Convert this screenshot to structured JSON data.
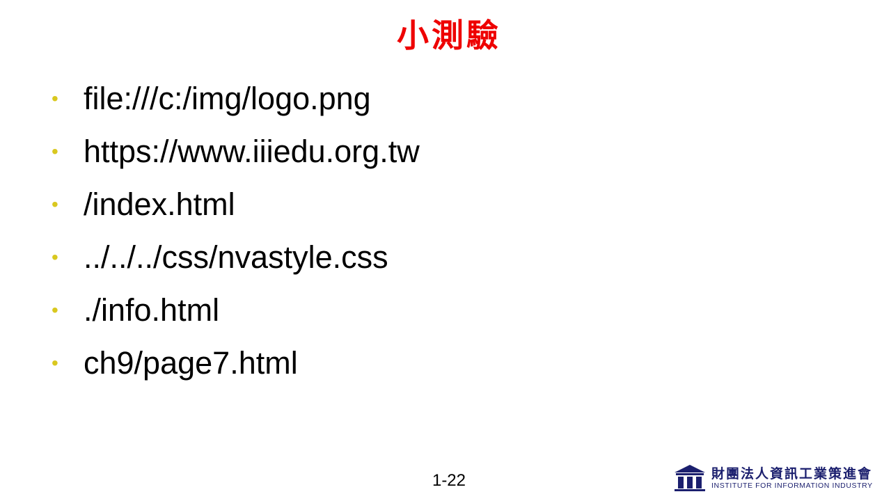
{
  "slide": {
    "title": "小測驗",
    "bullet_glyph": "•",
    "bullets": [
      "file:///c:/img/logo.png",
      "https://www.iiiedu.org.tw",
      "/index.html",
      "../../../css/nvastyle.css",
      "./info.html",
      "ch9/page7.html"
    ],
    "page_number": "1-22"
  },
  "logo": {
    "chinese_name": "財團法人資訊工業策進會",
    "english_name": "INSTITUTE FOR INFORMATION INDUSTRY",
    "icon": "building-columns-icon"
  },
  "colors": {
    "title": "#ee0000",
    "bullet": "#d9c81f",
    "text": "#000000",
    "logo": "#1b1f6e"
  }
}
